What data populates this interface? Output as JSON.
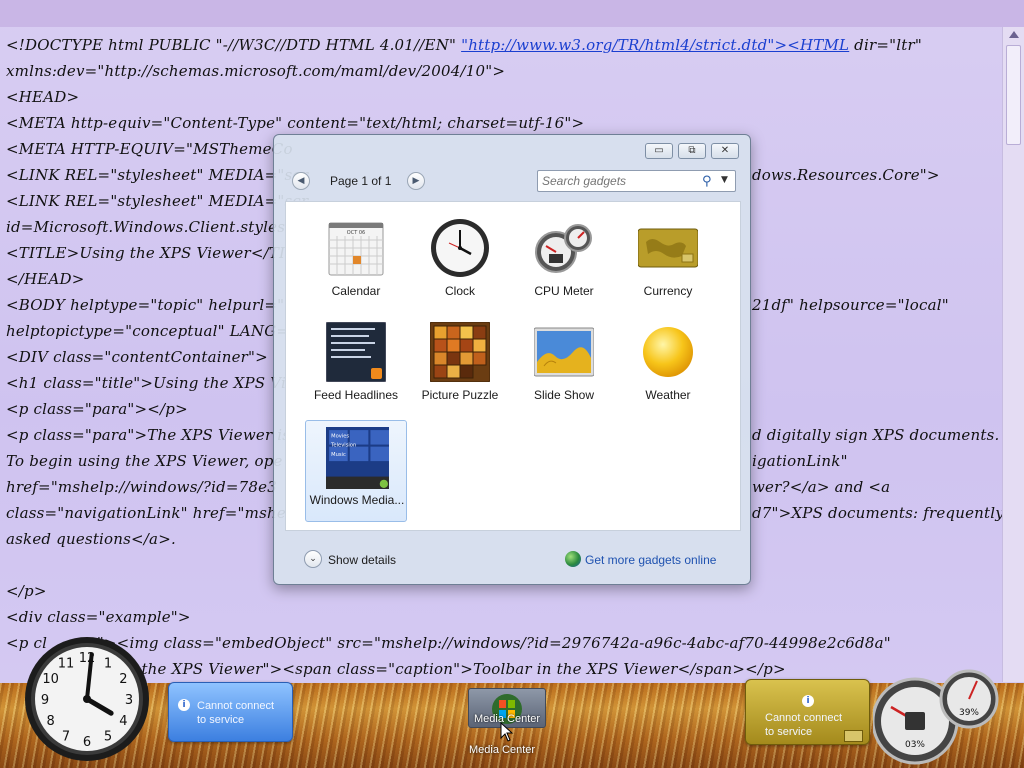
{
  "editor": {
    "lines": [
      {
        "text": "<!DOCTYPE html PUBLIC \"-//W3C//DTD HTML 4.01//EN\" ",
        "link": "\"http://www.w3.org/TR/html4/strict.dtd\"><HTML",
        "tail": " dir=\"ltr\""
      },
      {
        "text": "xmlns:dev=\"http://schemas.microsoft.com/maml/dev/2004/10\">"
      },
      {
        "text": "<HEAD>"
      },
      {
        "text": "<META http-equiv=\"Content-Type\" content=\"text/html; charset=utf-16\">"
      },
      {
        "text": "<META HTTP-EQUIV=\"MSThemeCo"
      },
      {
        "text": "<LINK REL=\"stylesheet\" MEDIA=\"scr",
        "right": "dows.Resources.Core\">"
      },
      {
        "text": "<LINK REL=\"stylesheet\" MEDIA=\"scr"
      },
      {
        "text": "id=Microsoft.Windows.Client.styleshe"
      },
      {
        "text": "<TITLE>Using the XPS Viewer</TIT"
      },
      {
        "text": "</HEAD>"
      },
      {
        "text": "<BODY helptype=\"topic\" helpurl=\"m",
        "right": "21df\" helpsource=\"local\""
      },
      {
        "text": "helptopictype=\"conceptual\" LANG=\""
      },
      {
        "text": "<DIV class=\"contentContainer\">"
      },
      {
        "text": "<h1 class=\"title\">Using the XPS Vie"
      },
      {
        "text": "<p class=\"para\"></p>"
      },
      {
        "text": "<p class=\"para\">The XPS Viewer is",
        "right": "d digitally sign XPS documents."
      },
      {
        "text": "To begin using the XPS Viewer, ope",
        "right": "igationLink\""
      },
      {
        "text": "href=\"mshelp://windows/?id=78e3",
        "right": "wer?</a> and <a"
      },
      {
        "text": "class=\"navigationLink\" href=\"mshelp",
        "right": "d7\">XPS documents: frequently"
      },
      {
        "text": "asked questions</a>."
      },
      {
        "text": ""
      },
      {
        "text": "</p>"
      },
      {
        "text": "<div class=\"example\">"
      },
      {
        "text": "<p cl          \"><img class=\"embedObject\" src=\"mshelp://windows/?id=2976742a-a96c-4abc-af70-44998e2c6d8a\""
      },
      {
        "text": "           toolbar in the XPS Viewer\"><span class=\"caption\">Toolbar in the XPS Viewer</span></p>"
      }
    ]
  },
  "gallery": {
    "window_buttons": {
      "minimize": "▭",
      "restore": "⧉",
      "close": "✕"
    },
    "pager": {
      "prev": "◀",
      "next": "▶",
      "text": "Page 1 of 1"
    },
    "search": {
      "placeholder": "Search gadgets",
      "icon": "⚲",
      "dropdown": "▼"
    },
    "gadgets": [
      {
        "id": "calendar",
        "label": "Calendar",
        "icon": "calendar-icon"
      },
      {
        "id": "clock",
        "label": "Clock",
        "icon": "clock-icon"
      },
      {
        "id": "cpu-meter",
        "label": "CPU Meter",
        "icon": "cpu-meter-icon"
      },
      {
        "id": "currency",
        "label": "Currency",
        "icon": "currency-icon"
      },
      {
        "id": "feed-headlines",
        "label": "Feed Headlines",
        "icon": "feed-icon"
      },
      {
        "id": "picture-puzzle",
        "label": "Picture Puzzle",
        "icon": "puzzle-icon"
      },
      {
        "id": "slide-show",
        "label": "Slide Show",
        "icon": "slideshow-icon"
      },
      {
        "id": "weather",
        "label": "Weather",
        "icon": "weather-icon"
      },
      {
        "id": "windows-media",
        "label": "Windows Media...",
        "icon": "media-center-icon",
        "selected": true
      }
    ],
    "calendar_month": "OCT 06",
    "media_menu": [
      "Movies",
      "Television",
      "Music"
    ],
    "show_details": "Show details",
    "get_more": "Get more gadgets online"
  },
  "desktop": {
    "clock": {
      "hour": 4,
      "minute": 1
    },
    "blue_bubble": {
      "msg_line1": "Cannot connect",
      "msg_line2": "to service"
    },
    "media_tile_label": "Media Center",
    "media_caption": "Media Center",
    "yellow_bubble": {
      "msg_line1": "Cannot connect",
      "msg_line2": "to service"
    },
    "cpu": {
      "cpu_percent": "03%",
      "memory_percent": "39%"
    }
  },
  "colors": {
    "link": "#1a3fd0",
    "online_link": "#1f52b0",
    "selection": "#d9e8fb"
  }
}
